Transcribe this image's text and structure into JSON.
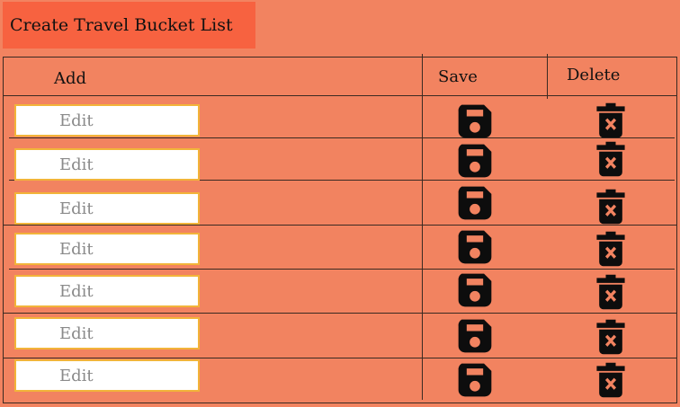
{
  "title": "Create Travel Bucket List",
  "headers": {
    "add": "Add",
    "save": "Save",
    "delete": "Delete"
  },
  "rows": [
    {
      "placeholder": "Edit",
      "save_icon": "save-icon",
      "delete_icon": "delete-icon"
    },
    {
      "placeholder": "Edit",
      "save_icon": "save-icon",
      "delete_icon": "delete-icon"
    },
    {
      "placeholder": "Edit",
      "save_icon": "save-icon",
      "delete_icon": "delete-icon"
    },
    {
      "placeholder": "Edit",
      "save_icon": "save-icon",
      "delete_icon": "delete-icon"
    },
    {
      "placeholder": "Edit",
      "save_icon": "save-icon",
      "delete_icon": "delete-icon"
    },
    {
      "placeholder": "Edit",
      "save_icon": "save-icon",
      "delete_icon": "delete-icon"
    },
    {
      "placeholder": "Edit",
      "save_icon": "save-icon",
      "delete_icon": "delete-icon"
    }
  ],
  "colors": {
    "background": "#f28360",
    "title_box": "#f76240",
    "input_border": "#f2b43a"
  }
}
